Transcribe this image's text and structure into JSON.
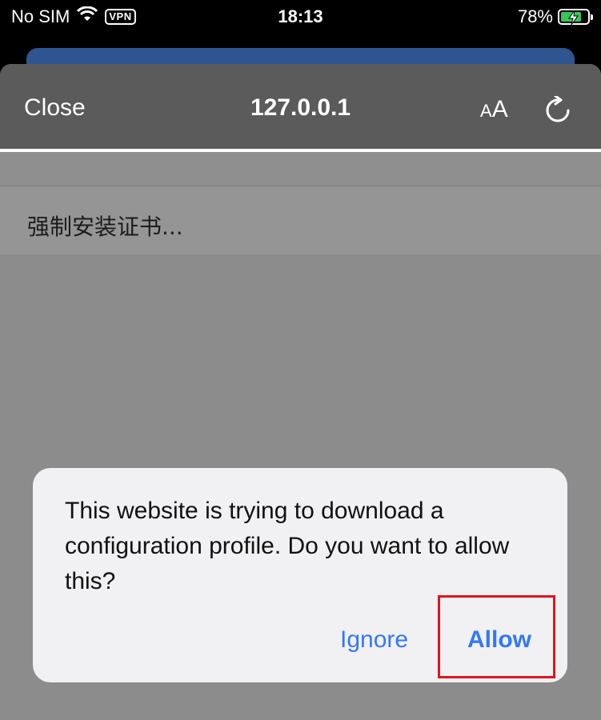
{
  "status_bar": {
    "carrier": "No SIM",
    "vpn_label": "VPN",
    "time": "18:13",
    "battery_percent": "78%",
    "battery_level": 0.78,
    "icons": [
      "wifi-icon",
      "battery-charging-icon"
    ]
  },
  "browser": {
    "close_label": "Close",
    "address": "127.0.0.1",
    "text_size_small": "A",
    "text_size_large": "A",
    "page_text": "强制安装证书..."
  },
  "alert": {
    "message": "This website is trying to download a configuration profile. Do you want to allow this?",
    "ignore_label": "Ignore",
    "allow_label": "Allow"
  },
  "colors": {
    "accent": "#3478f6",
    "highlight": "#e1141c",
    "battery": "#34c759"
  }
}
